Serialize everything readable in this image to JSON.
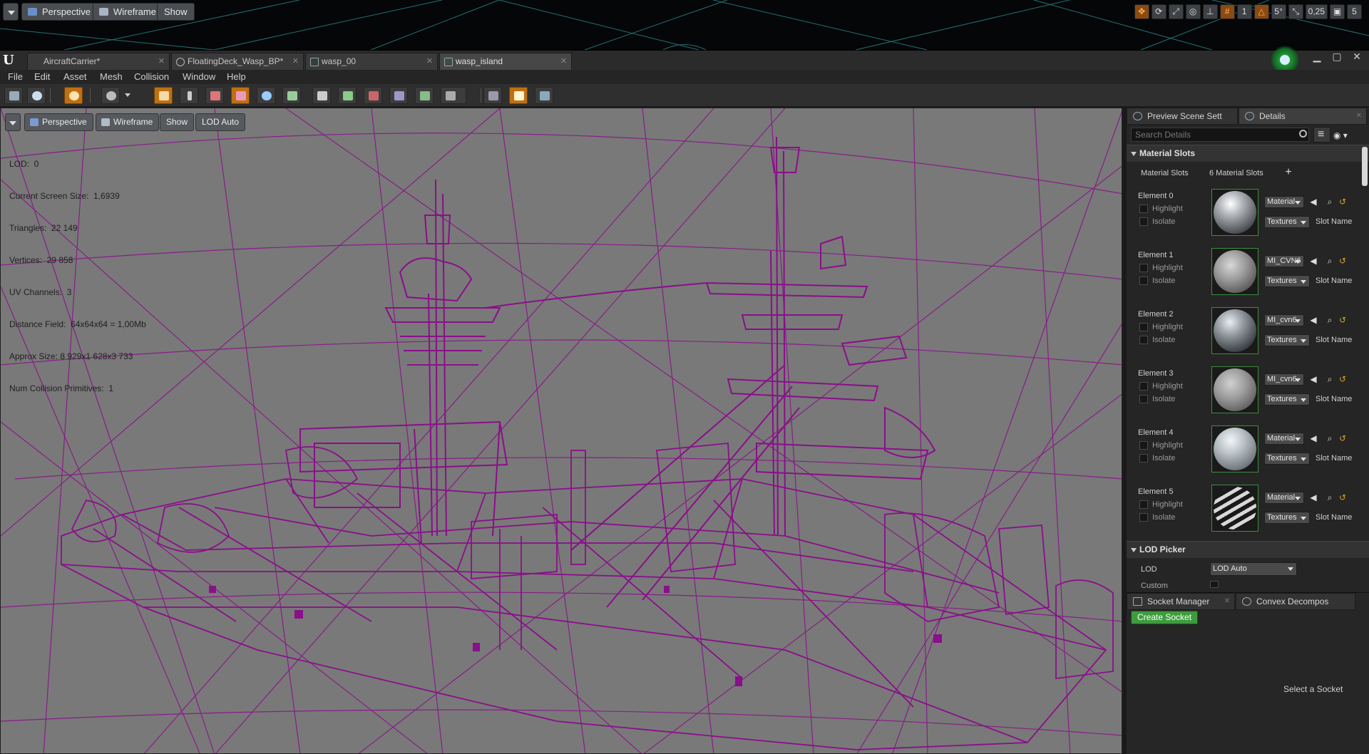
{
  "top_viewport": {
    "perspective": "Perspective",
    "wireframe": "Wireframe",
    "show": "Show",
    "icons": [
      {
        "name": "translate-icon",
        "text": ""
      },
      {
        "name": "rotate-icon",
        "text": ""
      },
      {
        "name": "scale-icon",
        "text": ""
      },
      {
        "name": "world-local-icon",
        "text": ""
      },
      {
        "name": "surface-snap-icon",
        "text": ""
      },
      {
        "name": "grid-snap-icon",
        "text": ""
      },
      {
        "name": "grid-size",
        "text": "1"
      },
      {
        "name": "rotation-snap-icon",
        "text": ""
      },
      {
        "name": "rotation-snap-value",
        "text": "5°"
      },
      {
        "name": "scale-snap-icon",
        "text": ""
      },
      {
        "name": "scale-snap-value",
        "text": "0,25"
      },
      {
        "name": "camera-speed-icon",
        "text": ""
      },
      {
        "name": "camera-speed-value",
        "text": "5"
      }
    ]
  },
  "tabs": [
    {
      "label": "AircraftCarrier*",
      "active": false
    },
    {
      "label": "FloatingDeck_Wasp_BP*",
      "active": false
    },
    {
      "label": "wasp_00",
      "active": false
    },
    {
      "label": "wasp_island",
      "active": true
    }
  ],
  "menu": [
    "File",
    "Edit",
    "Asset",
    "Mesh",
    "Collision",
    "Window",
    "Help"
  ],
  "viewport": {
    "perspective": "Perspective",
    "wireframe": "Wireframe",
    "show": "Show",
    "lod": "LOD Auto",
    "stats": [
      "LOD:  0",
      "Current Screen Size:  1,6939",
      "Triangles:  22 149",
      "Vertices:  29 858",
      "UV Channels:  3",
      "Distance Field:  64x64x64 = 1,00Mb",
      "Approx Size: 8 929x1 628x3 733",
      "Num Collision Primitives:  1"
    ]
  },
  "panel": {
    "tabs": [
      "Preview Scene Sett",
      "Details"
    ],
    "search_placeholder": "Search Details",
    "material_slots_header": "Material Slots",
    "material_slots_label": "Material Slots",
    "material_slots_count": "6 Material Slots",
    "highlight": "Highlight",
    "isolate": "Isolate",
    "textures": "Textures",
    "slot_name": "Slot Name",
    "elements": [
      {
        "label": "Element 0",
        "material": "Material"
      },
      {
        "label": "Element 1",
        "material": "MI_CVN6"
      },
      {
        "label": "Element 2",
        "material": "MI_cvn6"
      },
      {
        "label": "Element 3",
        "material": "MI_cvn6"
      },
      {
        "label": "Element 4",
        "material": "Material"
      },
      {
        "label": "Element 5",
        "material": "Material"
      }
    ],
    "lod_picker_header": "LOD Picker",
    "lod_label": "LOD",
    "lod_value": "LOD Auto",
    "custom_label": "Custom",
    "bottom_tabs": [
      "Socket Manager",
      "Convex Decompos"
    ],
    "create_socket": "Create Socket",
    "select_socket": "Select a Socket"
  },
  "colors": {
    "wireframe": "#8a0f8a",
    "viewport_bg": "#797979",
    "accent_orange": "#c07010",
    "accent_green": "#3d9d3d"
  }
}
